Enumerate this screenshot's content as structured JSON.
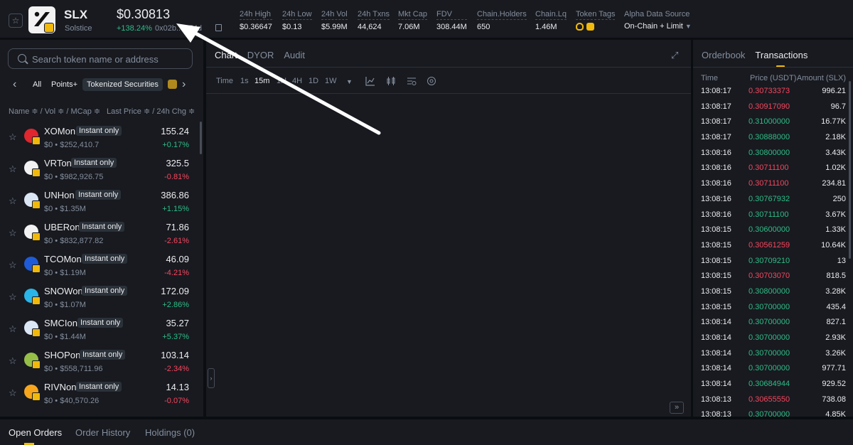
{
  "header": {
    "symbol": "SLX",
    "name": "Solstice",
    "price": "$0.30813",
    "change": "+138.24%",
    "address": "0x02b... c54d",
    "stats": [
      {
        "label": "24h High",
        "value": "$0.36647"
      },
      {
        "label": "24h Low",
        "value": "$0.13"
      },
      {
        "label": "24h Vol",
        "value": "$5.99M"
      },
      {
        "label": "24h Txns",
        "value": "44,624"
      },
      {
        "label": "Mkt Cap",
        "value": "7.06M"
      },
      {
        "label": "FDV",
        "value": "308.44M"
      },
      {
        "label": "Chain.Holders",
        "value": "650"
      },
      {
        "label": "Chain.Lq",
        "value": "1.46M"
      }
    ],
    "token_tags_label": "Token Tags",
    "source_label": "Alpha Data Source",
    "source_value": "On-Chain + Limit"
  },
  "sidebar": {
    "search_placeholder": "Search token name or address",
    "filters": [
      "All",
      "Points+",
      "Tokenized Securities"
    ],
    "col_left": "Name ≑ / Vol ≑ / MCap ≑",
    "col_right": "Last Price ≑ / 24h Chg ≑",
    "tokens": [
      {
        "name": "XOMon",
        "badge": "Instant only",
        "sub": "$0 • $252,410.7",
        "price": "155.24",
        "chg": "+0.17%",
        "dir": "up",
        "icon_color": "#e0262e"
      },
      {
        "name": "VRTon",
        "badge": "Instant only",
        "sub": "$0 • $982,926.75",
        "price": "325.5",
        "chg": "-0.81%",
        "dir": "down",
        "icon_color": "#f2f2f2"
      },
      {
        "name": "UNHon",
        "badge": "Instant only",
        "sub": "$0 • $1.35M",
        "price": "386.86",
        "chg": "+1.15%",
        "dir": "up",
        "icon_color": "#dbe6f5"
      },
      {
        "name": "UBERon",
        "badge": "Instant only",
        "sub": "$0 • $832,877.82",
        "price": "71.86",
        "chg": "-2.61%",
        "dir": "down",
        "icon_color": "#f2f2f2"
      },
      {
        "name": "TCOMon",
        "badge": "Instant only",
        "sub": "$0 • $1.19M",
        "price": "46.09",
        "chg": "-4.21%",
        "dir": "down",
        "icon_color": "#1e5bd8"
      },
      {
        "name": "SNOWon",
        "badge": "Instant only",
        "sub": "$0 • $1.07M",
        "price": "172.09",
        "chg": "+2.86%",
        "dir": "up",
        "icon_color": "#29b5e8"
      },
      {
        "name": "SMCIon",
        "badge": "Instant only",
        "sub": "$0 • $1.44M",
        "price": "35.27",
        "chg": "+5.37%",
        "dir": "up",
        "icon_color": "#dbe6f5"
      },
      {
        "name": "SHOPon",
        "badge": "Instant only",
        "sub": "$0 • $558,711.96",
        "price": "103.14",
        "chg": "-2.34%",
        "dir": "down",
        "icon_color": "#95bf47"
      },
      {
        "name": "RIVNon",
        "badge": "Instant only",
        "sub": "$0 • $40,570.26",
        "price": "14.13",
        "chg": "-0.07%",
        "dir": "down",
        "icon_color": "#f7a61b"
      }
    ]
  },
  "chart": {
    "tabs": [
      "Chart",
      "DYOR",
      "Audit"
    ],
    "toolbar": [
      "Time",
      "1s",
      "15m",
      "1H",
      "4H",
      "1D",
      "1W"
    ],
    "active_interval": "15m"
  },
  "transactions": {
    "tabs": [
      "Orderbook",
      "Transactions"
    ],
    "headers": [
      "Time",
      "Price (USDT)",
      "Amount (SLX)"
    ],
    "rows": [
      {
        "time": "13:08:17",
        "price": "0.30733373",
        "amount": "996.21",
        "dir": "down"
      },
      {
        "time": "13:08:17",
        "price": "0.30917090",
        "amount": "96.7",
        "dir": "down"
      },
      {
        "time": "13:08:17",
        "price": "0.31000000",
        "amount": "16.77K",
        "dir": "up"
      },
      {
        "time": "13:08:17",
        "price": "0.30888000",
        "amount": "2.18K",
        "dir": "up"
      },
      {
        "time": "13:08:16",
        "price": "0.30800000",
        "amount": "3.43K",
        "dir": "up"
      },
      {
        "time": "13:08:16",
        "price": "0.30711100",
        "amount": "1.02K",
        "dir": "down"
      },
      {
        "time": "13:08:16",
        "price": "0.30711100",
        "amount": "234.81",
        "dir": "down"
      },
      {
        "time": "13:08:16",
        "price": "0.30767932",
        "amount": "250",
        "dir": "up"
      },
      {
        "time": "13:08:16",
        "price": "0.30711100",
        "amount": "3.67K",
        "dir": "up"
      },
      {
        "time": "13:08:15",
        "price": "0.30600000",
        "amount": "1.33K",
        "dir": "up"
      },
      {
        "time": "13:08:15",
        "price": "0.30561259",
        "amount": "10.64K",
        "dir": "down"
      },
      {
        "time": "13:08:15",
        "price": "0.30709210",
        "amount": "13",
        "dir": "up"
      },
      {
        "time": "13:08:15",
        "price": "0.30703070",
        "amount": "818.5",
        "dir": "down"
      },
      {
        "time": "13:08:15",
        "price": "0.30800000",
        "amount": "3.28K",
        "dir": "up"
      },
      {
        "time": "13:08:15",
        "price": "0.30700000",
        "amount": "435.4",
        "dir": "up"
      },
      {
        "time": "13:08:14",
        "price": "0.30700000",
        "amount": "827.1",
        "dir": "up"
      },
      {
        "time": "13:08:14",
        "price": "0.30700000",
        "amount": "2.93K",
        "dir": "up"
      },
      {
        "time": "13:08:14",
        "price": "0.30700000",
        "amount": "3.26K",
        "dir": "up"
      },
      {
        "time": "13:08:14",
        "price": "0.30700000",
        "amount": "977.71",
        "dir": "up"
      },
      {
        "time": "13:08:14",
        "price": "0.30684944",
        "amount": "929.52",
        "dir": "up"
      },
      {
        "time": "13:08:13",
        "price": "0.30655550",
        "amount": "738.08",
        "dir": "down"
      },
      {
        "time": "13:08:13",
        "price": "0.30700000",
        "amount": "4.85K",
        "dir": "up"
      }
    ]
  },
  "bottom": {
    "tabs": [
      "Open Orders",
      "Order History",
      "Holdings (0)"
    ]
  },
  "colors": {
    "up": "#2ebd85",
    "down": "#f6465d",
    "accent": "#f0b90b"
  }
}
